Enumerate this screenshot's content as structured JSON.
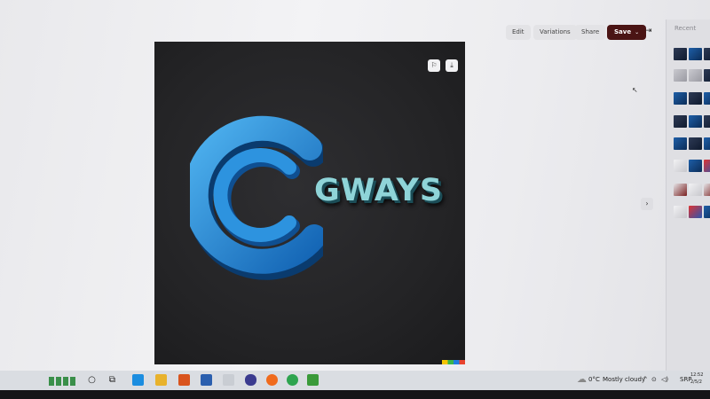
{
  "toolbar": {
    "edit_label": "Edit",
    "variations_label": "Variations",
    "share_label": "Share",
    "save_label": "Save"
  },
  "recent": {
    "title": "Recent"
  },
  "image": {
    "wordmark": "GWAYS"
  },
  "taskbar": {
    "weather_temp": "0°C",
    "weather_text": "Mostly cloudy",
    "language": "SRP",
    "time": "12:52",
    "date": "2/5/2"
  },
  "icons": [
    "flag-icon",
    "download-icon",
    "collapse-panel-icon",
    "chevron-right-icon",
    "search-icon",
    "task-view-icon",
    "windows-icon"
  ],
  "colors": {
    "save_button": "#4a1414",
    "wordmark": "#8fd4d8",
    "logo_blue": "#2a8fd8",
    "image_background": "#262628"
  }
}
